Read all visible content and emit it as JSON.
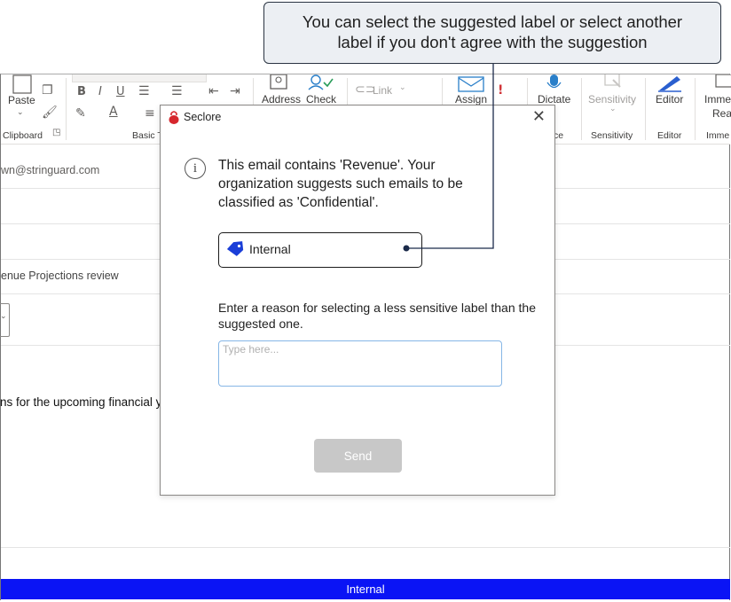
{
  "callout": {
    "line1": "You can select the suggested label or select another",
    "line2": "label if you don't agree with the suggestion"
  },
  "ribbon": {
    "paste_label": "Paste",
    "clipboard_group": "Clipboard",
    "basic_text_group": "Basic Te",
    "link_label": "Link",
    "address_label": "Address",
    "check_label": "Check",
    "assign_label": "Assign",
    "dictate_label": "Dictate",
    "voice_group": "ce",
    "sensitivity_label": "Sensitivity",
    "sensitivity_group": "Sensitivity",
    "editor_label": "Editor",
    "editor_group": "Editor",
    "immersive_label_1": "Imme",
    "immersive_label_2": "Rea",
    "immersive_group": "Imme"
  },
  "email": {
    "from_fragment": "wn@stringuard.com",
    "subject_fragment": "enue Projections review",
    "body_fragment": "ns for the upcoming financial y"
  },
  "dialog": {
    "title": "Seclore",
    "message": "This email contains 'Revenue'. Your organization suggests such emails to be classified as 'Confidential'.",
    "selected_label": "Internal",
    "reason_prompt": "Enter a reason for selecting a less sensitive label than the suggested one.",
    "reason_placeholder": "Type here...",
    "send_label": "Send"
  },
  "status_bar": {
    "label": "Internal",
    "color": "#0a14f5"
  },
  "colors": {
    "tag_blue": "#1a3ed8",
    "seclore_red": "#d6272d",
    "callout_bg": "#eceff3"
  }
}
